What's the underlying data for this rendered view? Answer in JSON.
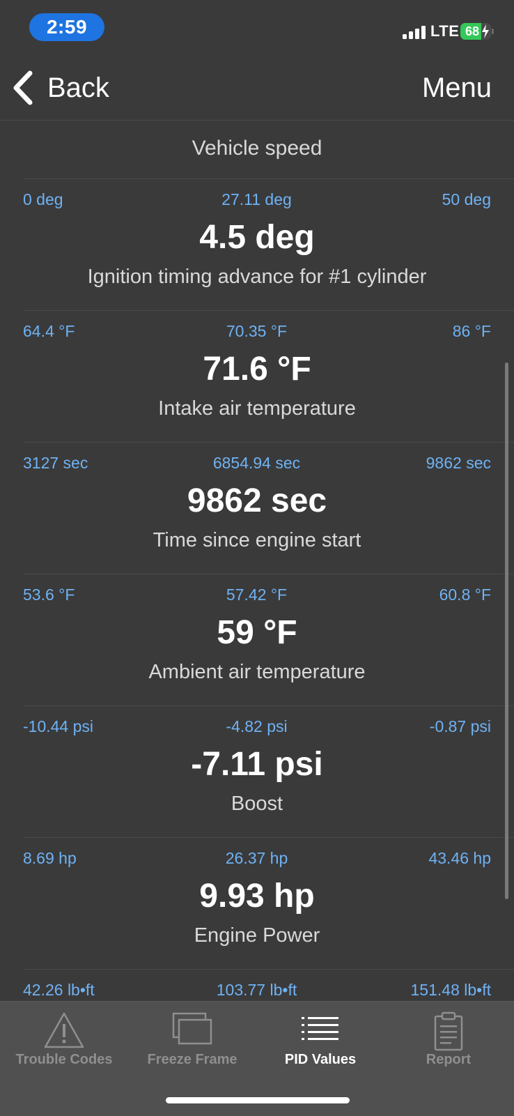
{
  "status_bar": {
    "time": "2:59",
    "network": "LTE",
    "battery": "68",
    "battery_level": 0.68
  },
  "nav": {
    "back_label": "Back",
    "menu_label": "Menu"
  },
  "list": {
    "header_label": "Vehicle speed",
    "items": [
      {
        "min": "0 deg",
        "avg": "27.11 deg",
        "max": "50 deg",
        "value": "4.5 deg",
        "label": "Ignition timing advance for #1 cylinder"
      },
      {
        "min": "64.4 °F",
        "avg": "70.35 °F",
        "max": "86 °F",
        "value": "71.6 °F",
        "label": "Intake air temperature"
      },
      {
        "min": "3127 sec",
        "avg": "6854.94 sec",
        "max": "9862 sec",
        "value": "9862 sec",
        "label": "Time since engine start"
      },
      {
        "min": "53.6 °F",
        "avg": "57.42 °F",
        "max": "60.8 °F",
        "value": "59 °F",
        "label": "Ambient air temperature"
      },
      {
        "min": "-10.44 psi",
        "avg": "-4.82 psi",
        "max": "-0.87 psi",
        "value": "-7.11 psi",
        "label": "Boost"
      },
      {
        "min": "8.69 hp",
        "avg": "26.37 hp",
        "max": "43.46 hp",
        "value": "9.93 hp",
        "label": "Engine Power"
      },
      {
        "min": "42.26 lb•ft",
        "avg": "103.77 lb•ft",
        "max": "151.48 lb•ft",
        "value": "",
        "label": ""
      }
    ]
  },
  "tabs": [
    {
      "label": "Trouble Codes",
      "icon": "warning-triangle-icon"
    },
    {
      "label": "Freeze Frame",
      "icon": "stacked-frames-icon"
    },
    {
      "label": "PID Values",
      "icon": "list-icon"
    },
    {
      "label": "Report",
      "icon": "clipboard-icon"
    }
  ],
  "colors": {
    "background": "#3a3a3b",
    "accent_blue": "#6fb2f3",
    "time_pill": "#1e74e0",
    "battery_green": "#34c759",
    "tab_inactive": "#8f8f90"
  }
}
